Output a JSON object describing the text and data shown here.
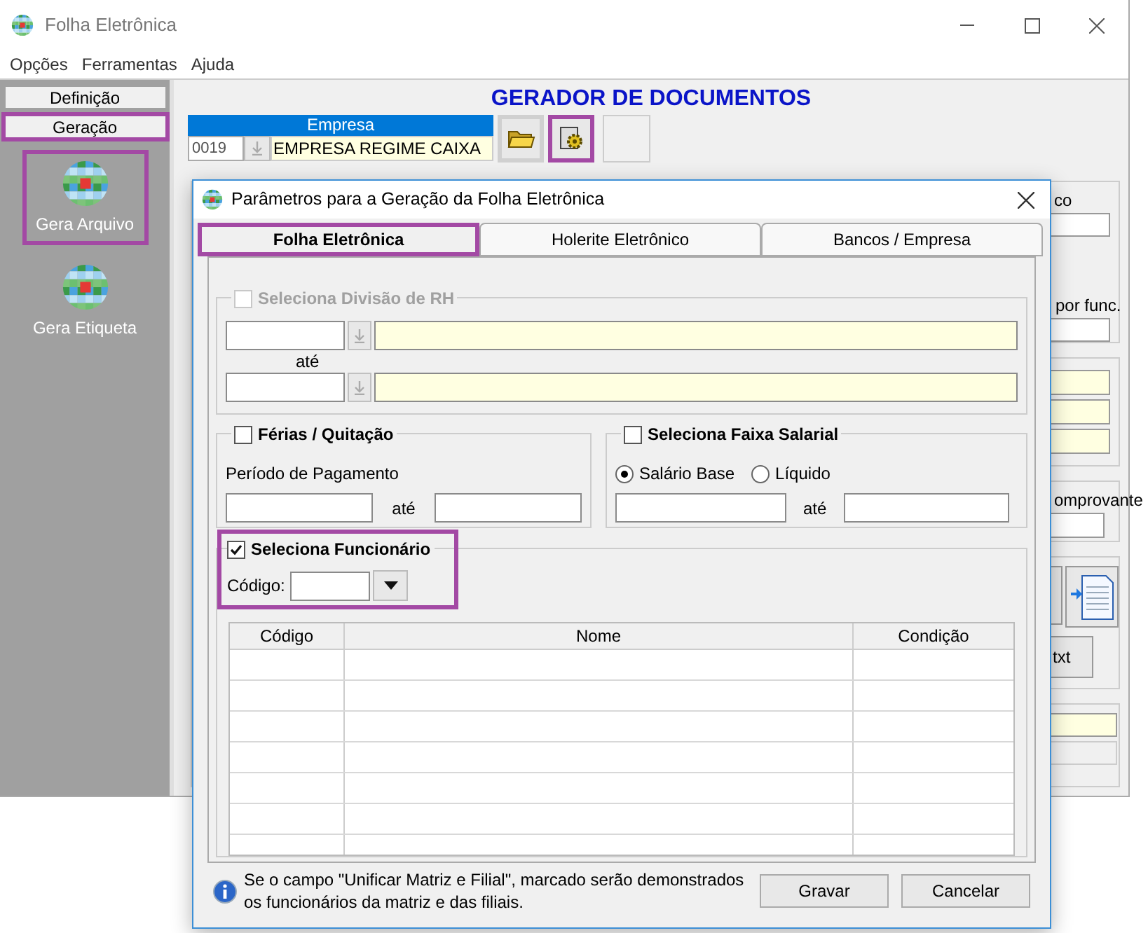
{
  "window": {
    "title": "Folha Eletrônica"
  },
  "menu": [
    "Opções",
    "Ferramentas",
    "Ajuda"
  ],
  "sidebar": {
    "tabs": [
      {
        "label": "Definição",
        "highlighted": false
      },
      {
        "label": "Geração",
        "highlighted": true
      }
    ],
    "items": [
      {
        "label": "Gera Arquivo",
        "highlighted": true
      },
      {
        "label": "Gera Etiqueta",
        "highlighted": false
      }
    ]
  },
  "main": {
    "title": "GERADOR DE DOCUMENTOS",
    "empresa": {
      "label": "Empresa",
      "code": "0019",
      "name": "EMPRESA REGIME CAIXA"
    },
    "toolbar": [
      {
        "kind": "open",
        "highlighted": false
      },
      {
        "kind": "generate",
        "highlighted": true
      }
    ],
    "side_labels": [
      "co",
      "por func.",
      "omprovante"
    ],
    "txt_button": "txt"
  },
  "dialog": {
    "title": "Parâmetros para a Geração da Folha Eletrônica",
    "tabs": [
      {
        "label": "Folha Eletrônica",
        "selected": true,
        "highlighted": true
      },
      {
        "label": "Holerite Eletrônico",
        "selected": false,
        "highlighted": false
      },
      {
        "label": "Bancos / Empresa",
        "selected": false,
        "highlighted": false
      }
    ],
    "divisao": {
      "label": "Seleciona Divisão de RH",
      "checked": false,
      "disabled": true,
      "range_label": "até"
    },
    "ferias": {
      "label": "Férias / Quitação",
      "checked": false,
      "period_label": "Período de Pagamento",
      "range_label": "até"
    },
    "faixa": {
      "label": "Seleciona Faixa Salarial",
      "checked": false,
      "range_label": "até",
      "options": [
        {
          "label": "Salário Base",
          "selected": true
        },
        {
          "label": "Líquido",
          "selected": false
        }
      ]
    },
    "funcionario": {
      "label": "Seleciona Funcionário",
      "checked": true,
      "highlighted": true,
      "code_label": "Código:",
      "columns": [
        "Código",
        "Nome",
        "Condição"
      ]
    },
    "note": "Se o campo \"Unificar Matriz e Filial\", marcado serão demonstrados os funcionários da matriz e das filiais.",
    "buttons": [
      "Gravar",
      "Cancelar"
    ]
  }
}
